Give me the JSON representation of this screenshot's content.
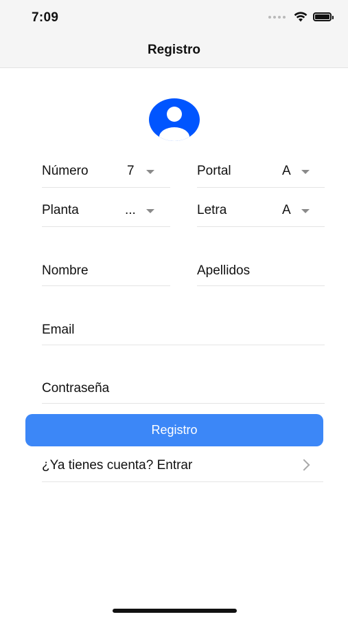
{
  "status_bar": {
    "time": "7:09",
    "icons": [
      "cellular-signal-icon",
      "wifi-icon",
      "battery-icon"
    ]
  },
  "nav": {
    "title": "Registro"
  },
  "avatar": {
    "icon": "user-avatar-icon",
    "color": "#0055ff"
  },
  "address": {
    "numero": {
      "label": "Número",
      "value": "7"
    },
    "portal": {
      "label": "Portal",
      "value": "A"
    },
    "planta": {
      "label": "Planta",
      "value": "..."
    },
    "letra": {
      "label": "Letra",
      "value": "A"
    }
  },
  "form": {
    "nombre_placeholder": "Nombre",
    "apellidos_placeholder": "Apellidos",
    "email_placeholder": "Email",
    "password_placeholder": "Contraseña"
  },
  "register_button": {
    "label": "Registro",
    "color": "#3c87f7"
  },
  "login_link": {
    "label": "¿Ya tienes cuenta? Entrar"
  }
}
